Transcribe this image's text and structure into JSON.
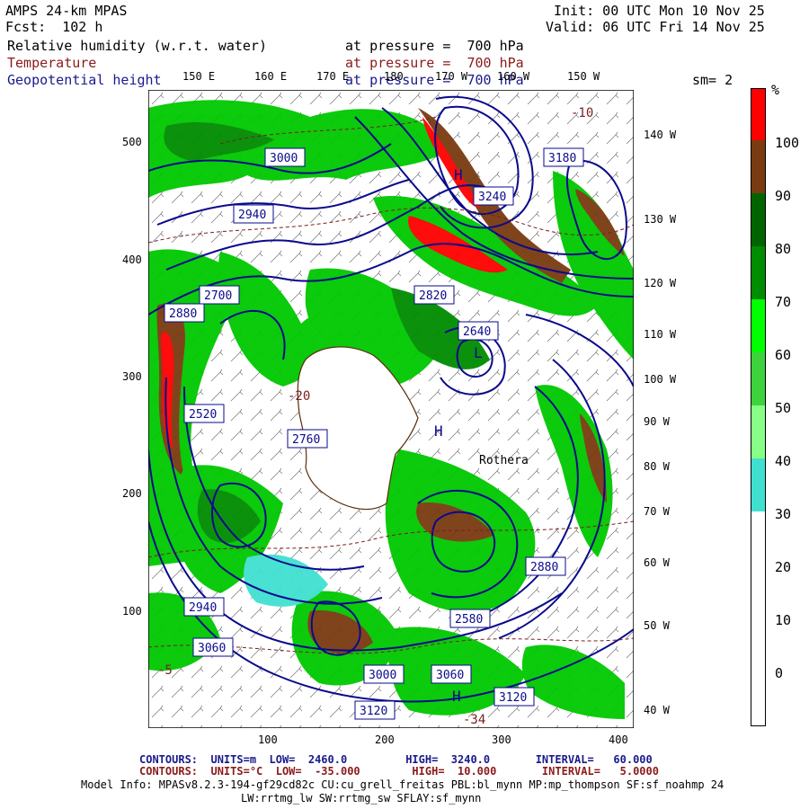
{
  "header": {
    "model": "AMPS 24-km MPAS",
    "fcst": "Fcst:  102 h",
    "init": "Init: 00 UTC Mon 10 Nov 25",
    "valid": "Valid: 06 UTC Fri 14 Nov 25",
    "field1": "Relative humidity (w.r.t. water)",
    "field1_level": "at pressure =  700 hPa",
    "field2": "Temperature",
    "field2_level": "at pressure =  700 hPa",
    "field3": "Geopotential height",
    "field3_level": "at pressure =  700 hPa",
    "smoothing": "sm= 2"
  },
  "lon_top": [
    "150 E",
    "160 E",
    "170 E",
    "180",
    "170 W",
    "160 W",
    "150 W"
  ],
  "lon_right": [
    "140 W",
    "130 W",
    "120 W",
    "110 W",
    "100 W",
    "90 W",
    "80 W",
    "70 W",
    "60 W",
    "50 W",
    "40 W"
  ],
  "y_ticks": [
    "500",
    "400",
    "300",
    "200",
    "100"
  ],
  "x_ticks": [
    "100",
    "200",
    "300",
    "400"
  ],
  "colorbar": {
    "unit": "%",
    "labels": [
      "100",
      "90",
      "80",
      "70",
      "60",
      "50",
      "40",
      "30",
      "20",
      "10",
      "0"
    ],
    "colors": {
      "c100": "#ff0000",
      "c90": "#7a3b10",
      "c80": "#006400",
      "c70": "#008c00",
      "c60": "#00ff00",
      "c50": "#3cd33c",
      "c40": "#87ff87",
      "c30": "#40e0d0",
      "c_low": "#ffffff"
    }
  },
  "height_contour_labels": [
    "3180",
    "3240",
    "3000",
    "2880",
    "2820",
    "2760",
    "2700",
    "2640",
    "2940",
    "3060",
    "3120",
    "2580",
    "2520",
    "2940",
    "3000",
    "3060",
    "3120",
    "2880"
  ],
  "temperature_contour_labels": [
    "-20",
    "-34",
    "-5",
    "-10"
  ],
  "map_symbols": [
    "H",
    "H",
    "H",
    "L"
  ],
  "place_labels": [
    "Rothera"
  ],
  "footer": {
    "line1": "CONTOURS:  UNITS=m  LOW=  2460.0         HIGH=  3240.0       INTERVAL=   60.000",
    "line2": "CONTOURS:  UNITS=°C  LOW=  -35.000        HIGH=  10.000       INTERVAL=   5.0000",
    "model_info": "Model Info: MPASv8.2.3-194-gf29cd82c CU:cu_grell_freitas PBL:bl_mynn MP:mp_thompson SF:sf_noahmp 24",
    "model_info2": "LW:rrtmg_lw SW:rrtmg_sw SFLAY:sf_mynn"
  }
}
